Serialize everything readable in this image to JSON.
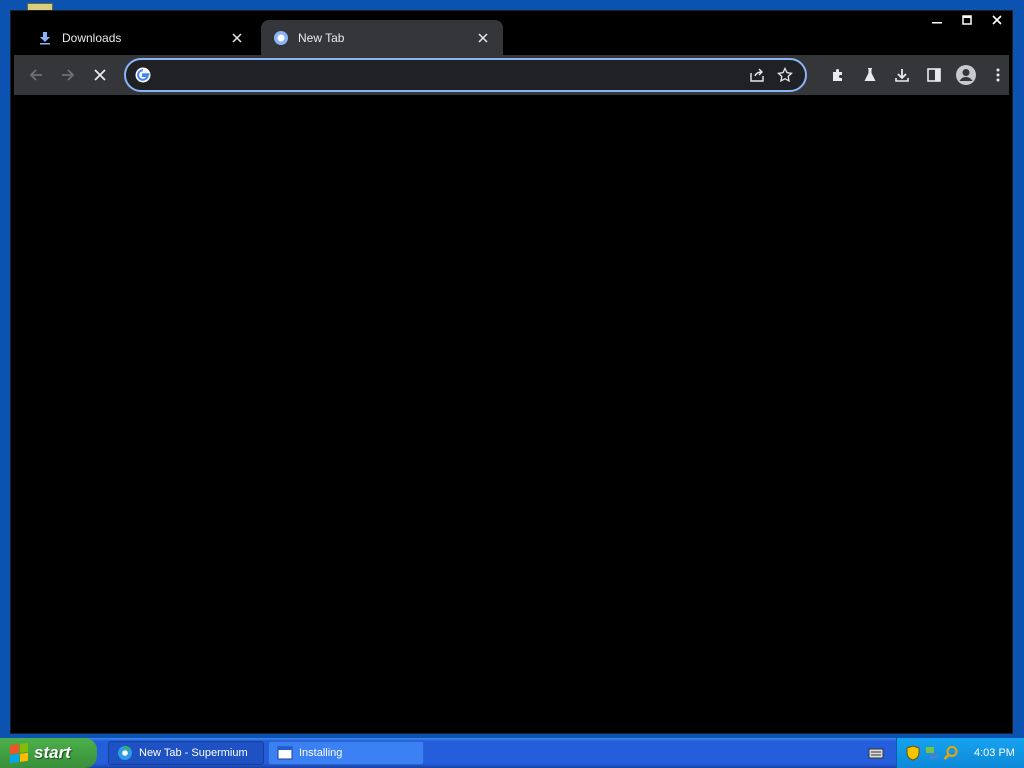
{
  "browser": {
    "tabs": [
      {
        "label": "Downloads",
        "icon": "download-icon",
        "active": false
      },
      {
        "label": "New Tab",
        "icon": "chrome-newtab-icon",
        "active": true
      }
    ],
    "window_controls": {
      "minimize": "minimize-icon",
      "maximize": "maximize-icon",
      "close": "close-icon"
    },
    "toolbar": {
      "back": "back-arrow-icon",
      "forward": "forward-arrow-icon",
      "stop": "stop-loading-icon",
      "omnibox": {
        "value": "",
        "placeholder": "",
        "search_engine_icon": "google-g-icon"
      },
      "share": "share-icon",
      "bookmark": "star-icon",
      "extensions": "puzzle-piece-icon",
      "labs": "flask-icon",
      "downloads": "download-icon",
      "side_panel": "side-panel-icon",
      "profile": "profile-avatar-icon",
      "menu": "kebab-menu-icon"
    }
  },
  "taskbar": {
    "start_label": "start",
    "items": [
      {
        "label": "New Tab - Supermium",
        "icon": "supermium-icon",
        "active": false
      },
      {
        "label": "Installing",
        "icon": "window-icon",
        "active": true
      }
    ],
    "tray": {
      "icons": [
        "keyboard-icon",
        "security-shield-icon",
        "network-icon",
        "search-icon"
      ],
      "time": "4:03 PM"
    }
  },
  "colors": {
    "accent": "#8ab4f8",
    "toolbar_bg": "#35363a",
    "taskbar_blue": "#245edb",
    "start_green": "#3a8f3a",
    "tray_blue": "#0e89d8"
  }
}
